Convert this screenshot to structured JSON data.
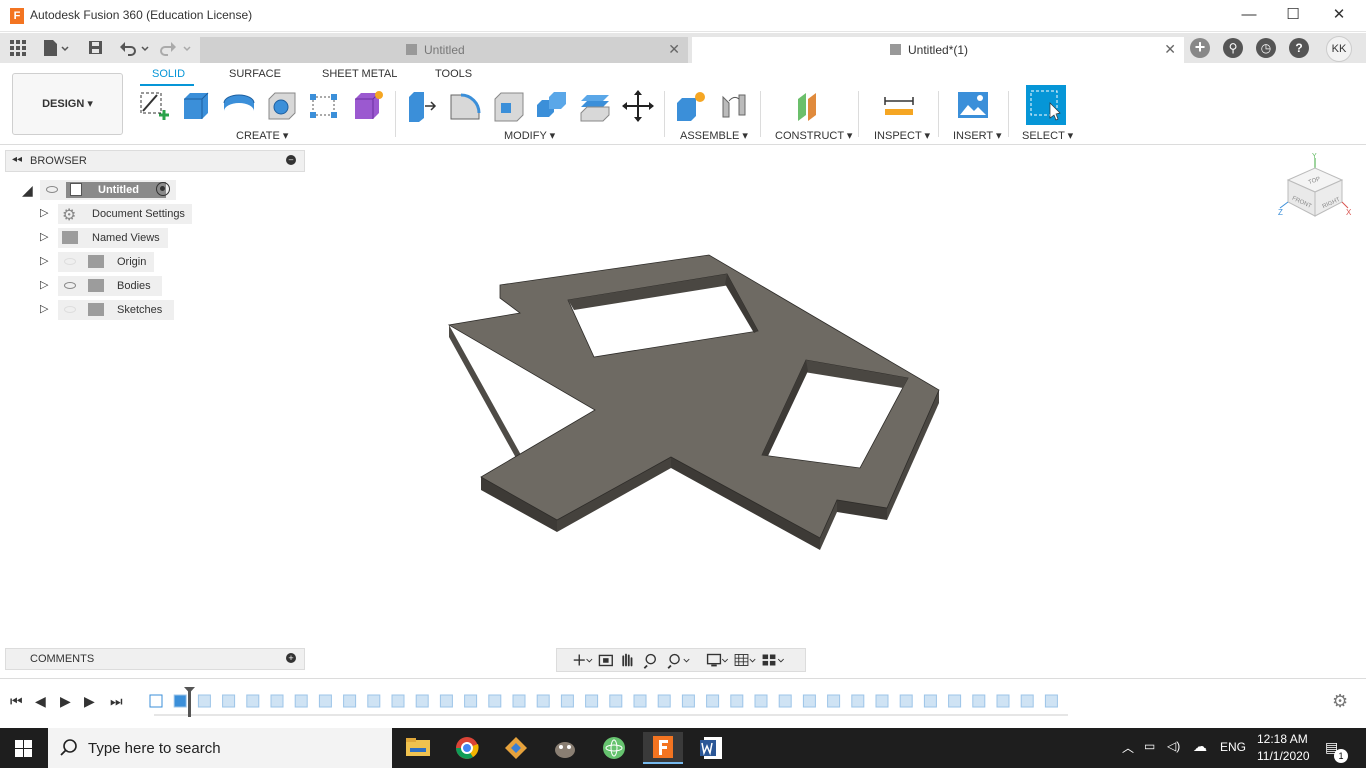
{
  "window": {
    "title": "Autodesk Fusion 360 (Education License)",
    "app_icon_letter": "F",
    "minimize": "—",
    "maximize": "☐",
    "close": "✕"
  },
  "tabs": [
    {
      "label": "Untitled",
      "active": false
    },
    {
      "label": "Untitled*(1)",
      "active": true
    }
  ],
  "user": {
    "initials": "KK"
  },
  "workspace": {
    "label": "DESIGN ▾"
  },
  "ribbon": {
    "tabs": [
      "SOLID",
      "SURFACE",
      "SHEET METAL",
      "TOOLS"
    ],
    "active_tab": "SOLID",
    "groups": {
      "create": "CREATE ▾",
      "modify": "MODIFY ▾",
      "assemble": "ASSEMBLE ▾",
      "construct": "CONSTRUCT ▾",
      "inspect": "INSPECT ▾",
      "insert": "INSERT ▾",
      "select": "SELECT ▾"
    }
  },
  "browser": {
    "title": "BROWSER",
    "root": "Untitled",
    "items": [
      {
        "label": "Document Settings",
        "icon": "gear-icon"
      },
      {
        "label": "Named Views",
        "icon": "folder-icon"
      },
      {
        "label": "Origin",
        "icon": "folder-icon"
      },
      {
        "label": "Bodies",
        "icon": "folder-icon"
      },
      {
        "label": "Sketches",
        "icon": "folder-icon"
      }
    ]
  },
  "comments": {
    "title": "COMMENTS"
  },
  "viewcube": {
    "top": "TOP",
    "front": "FRONT",
    "right": "RIGHT",
    "x": "X",
    "y": "Y",
    "z": "Z"
  },
  "taskbar": {
    "search_placeholder": "Type here to search",
    "language": "ENG",
    "time": "12:18 AM",
    "date": "11/1/2020",
    "notification_count": "1"
  },
  "colors": {
    "accent": "#0696d7",
    "model_face": "#6e6a63",
    "model_side": "#4a4741",
    "taskbar": "#1e1e1e"
  }
}
